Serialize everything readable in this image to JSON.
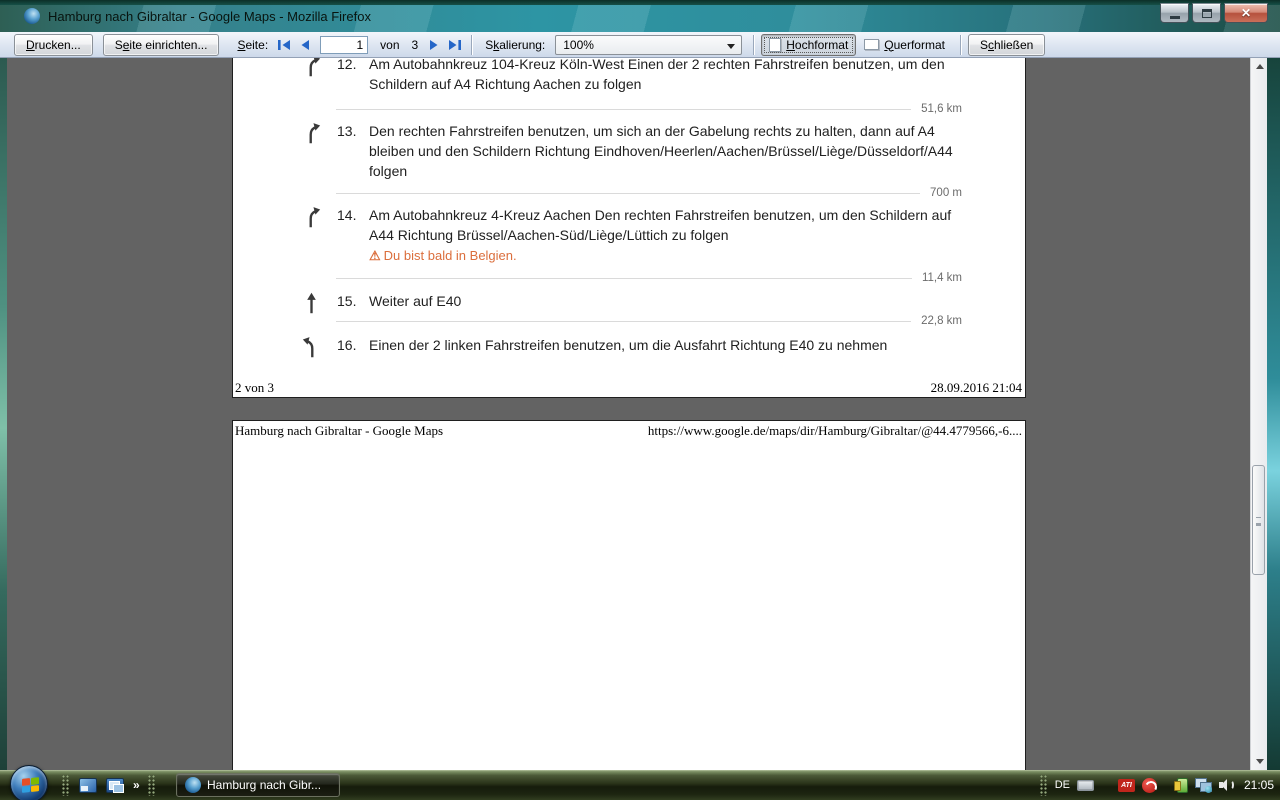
{
  "colors": {
    "warning_text": "#DB6E3C",
    "nav_arrow": "#2566C8"
  },
  "icons": {
    "close": "✕",
    "chevron": "»",
    "warning": "⚠"
  },
  "window": {
    "title": "Hamburg nach Gibraltar - Google Maps - Mozilla Firefox"
  },
  "toolbar": {
    "print": {
      "text": "Drucken...",
      "accel": 0
    },
    "page_setup": {
      "text": "Seite einrichten...",
      "accel": 1
    },
    "page_label": {
      "text": "Seite:",
      "accel": 0
    },
    "page_input_value": "1",
    "of_label": "von",
    "page_total": "3",
    "scale_label": {
      "text": "Skalierung:",
      "accel": 1
    },
    "scale_value": "100%",
    "portrait": {
      "text": "Hochformat",
      "accel": 0
    },
    "landscape": {
      "text": "Querformat",
      "accel": 0
    },
    "close": {
      "text": "Schließen",
      "accel": 1
    }
  },
  "preview": {
    "page2": {
      "steps": [
        {
          "num": "12.",
          "icon": "fork-right",
          "text": "Am Autobahnkreuz 104-Kreuz Köln-West Einen der 2 rechten Fahrstreifen benutzen, um den Schildern auf A4 Richtung Aachen zu folgen",
          "distance": "51,6 km"
        },
        {
          "num": "13.",
          "icon": "fork-right",
          "text": "Den rechten Fahrstreifen benutzen, um sich an der Gabelung rechts zu halten, dann auf A4 bleiben und den Schildern Richtung Eindhoven/Heerlen/Aachen/Brüssel/Liège/Düsseldorf/A44 folgen",
          "distance": "700 m"
        },
        {
          "num": "14.",
          "icon": "fork-right",
          "text": "Am Autobahnkreuz 4-Kreuz Aachen Den rechten Fahrstreifen benutzen, um den Schildern auf A44 Richtung Brüssel/Aachen-Süd/Liège/Lüttich zu folgen",
          "warning": "Du bist bald in Belgien.",
          "distance": "11,4 km"
        },
        {
          "num": "15.",
          "icon": "straight",
          "text": "Weiter auf E40",
          "distance": "22,8 km"
        },
        {
          "num": "16.",
          "icon": "slight-left",
          "text": "Einen der 2 linken Fahrstreifen benutzen, um die Ausfahrt Richtung E40 zu nehmen"
        }
      ],
      "footer_left": "2 von 3",
      "footer_right": "28.09.2016 21:04"
    },
    "page3": {
      "header_left": "Hamburg nach Gibraltar - Google Maps",
      "header_right": "https://www.google.de/maps/dir/Hamburg/Gibraltar/@44.4779566,-6...."
    }
  },
  "taskbar": {
    "task_button_label": "Hamburg nach Gibr...",
    "tray": {
      "language": "DE",
      "clock": "21:05"
    }
  }
}
